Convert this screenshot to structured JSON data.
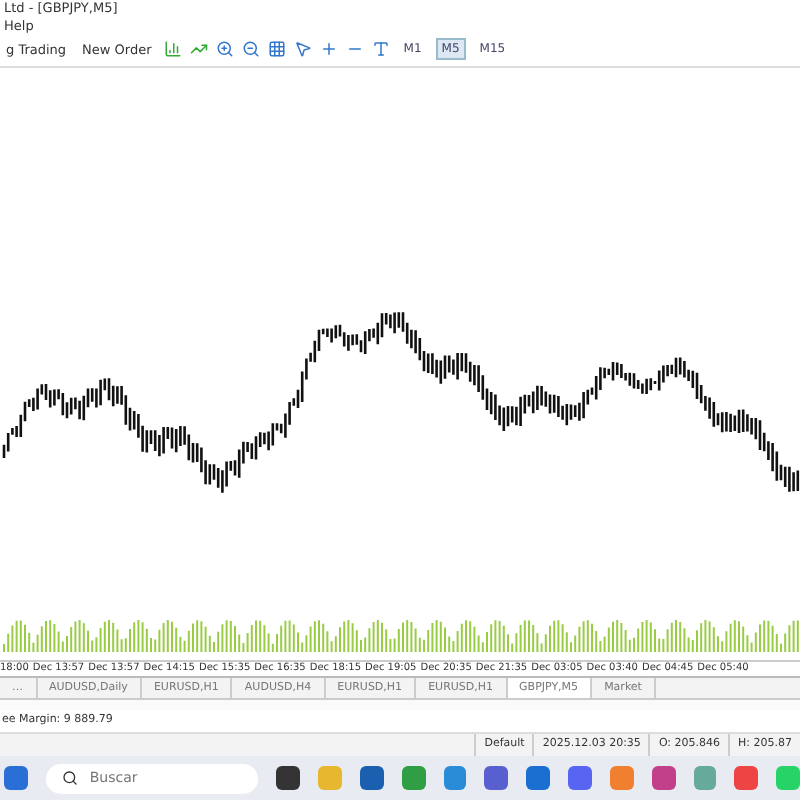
{
  "window": {
    "title": "Ltd - [GBPJPY,M5]"
  },
  "menu": [
    "Help"
  ],
  "toolbar": {
    "buttons": [
      {
        "label": "g Trading"
      },
      {
        "label": "New Order"
      }
    ],
    "timeframes": [
      {
        "label": "M1",
        "selected": false
      },
      {
        "label": "M5",
        "selected": true
      },
      {
        "label": "M15",
        "selected": false
      }
    ]
  },
  "time_axis": [
    "18:00",
    "Dec 13:57",
    "Dec 13:57",
    "Dec 14:15",
    "Dec 15:35",
    "Dec 16:35",
    "Dec 18:15",
    "Dec 19:05",
    "Dec 20:35",
    "Dec 21:35",
    "Dec 03:05",
    "Dec 03:40",
    "Dec 04:45",
    "Dec 05:40"
  ],
  "tabs": [
    {
      "label": "…",
      "selected": false
    },
    {
      "label": "AUDUSD,Daily",
      "selected": false
    },
    {
      "label": "EURUSD,H1",
      "selected": false
    },
    {
      "label": "AUDUSD,H4",
      "selected": false
    },
    {
      "label": "EURUSD,H1",
      "selected": false
    },
    {
      "label": "EURUSD,H1",
      "selected": false
    },
    {
      "label": "GBPJPY,M5",
      "selected": true
    },
    {
      "label": "Market",
      "selected": false
    }
  ],
  "account": "ee Margin: 9 889.79",
  "status_bar": [
    "Default",
    "2025.12.03 20:35",
    "O: 205.846",
    "H: 205.87"
  ],
  "taskbar": {
    "search": {
      "placeholder": "Buscar"
    }
  }
}
